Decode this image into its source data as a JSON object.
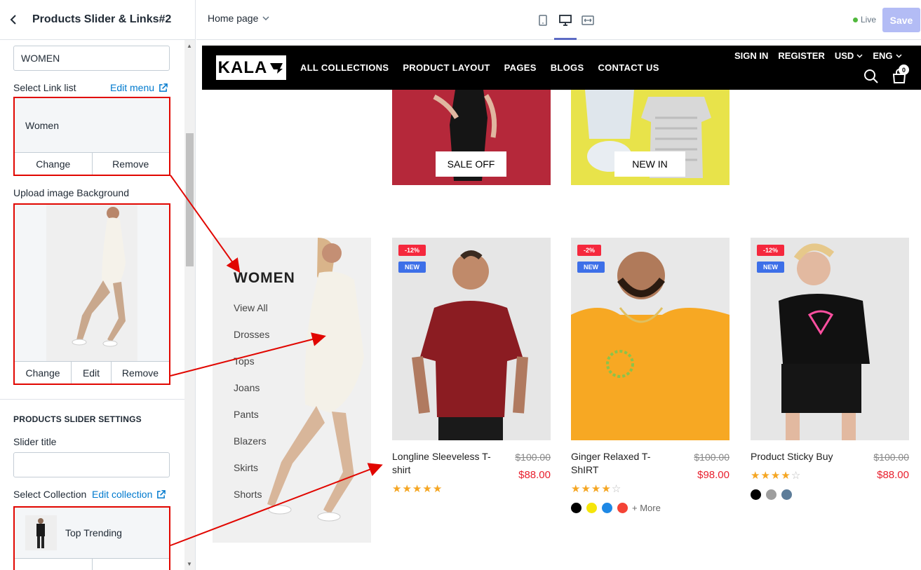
{
  "sidebar": {
    "title": "Products Slider & Links#2",
    "heading_value": "WOMEN",
    "link_list_label": "Select Link list",
    "edit_menu": "Edit menu",
    "link_list_value": "Women",
    "change": "Change",
    "remove": "Remove",
    "edit": "Edit",
    "upload_label": "Upload image Background",
    "section_title": "PRODUCTS SLIDER SETTINGS",
    "slider_title_label": "Slider title",
    "slider_title_value": "",
    "collection_label": "Select Collection",
    "edit_collection": "Edit collection",
    "collection_value": "Top Trending"
  },
  "topbar": {
    "page_select": "Home page",
    "live": "Live",
    "save": "Save"
  },
  "store": {
    "logo": "KALA",
    "nav": [
      "ALL COLLECTIONS",
      "PRODUCT LAYOUT",
      "PAGES",
      "BLOGS",
      "CONTACT US"
    ],
    "sign_in": "SIGN IN",
    "register": "REGISTER",
    "currency": "USD",
    "language": "ENG",
    "cart_count": "0"
  },
  "banners": [
    {
      "label": "SALE OFF",
      "color": "#b5283a"
    },
    {
      "label": "NEW IN",
      "color": "#e8e34a"
    }
  ],
  "women": {
    "title": "WOMEN",
    "items": [
      "View All",
      "Drosses",
      "Tops",
      "Joans",
      "Pants",
      "Blazers",
      "Skirts",
      "Shorts"
    ]
  },
  "products": [
    {
      "name": "Longline Sleeveless T-shirt",
      "old_price": "$100.00",
      "price": "$88.00",
      "sale": "-12%",
      "new": "NEW",
      "rating": 5,
      "swatches": []
    },
    {
      "name": "Ginger Relaxed T-ShIRT",
      "old_price": "$100.00",
      "price": "$98.00",
      "sale": "-2%",
      "new": "NEW",
      "rating": 4,
      "swatches": [
        "#000000",
        "#f5e50a",
        "#1e88e5",
        "#f44336"
      ],
      "more": "+ More"
    },
    {
      "name": "Product Sticky Buy",
      "old_price": "$100.00",
      "price": "$88.00",
      "sale": "-12%",
      "new": "NEW",
      "rating": 4,
      "swatches": [
        "#000000",
        "#9e9e9e",
        "#5c7c99"
      ]
    }
  ],
  "colors": {
    "annotation": "#e10600",
    "price": "#e8202e",
    "star": "#f5a623"
  }
}
